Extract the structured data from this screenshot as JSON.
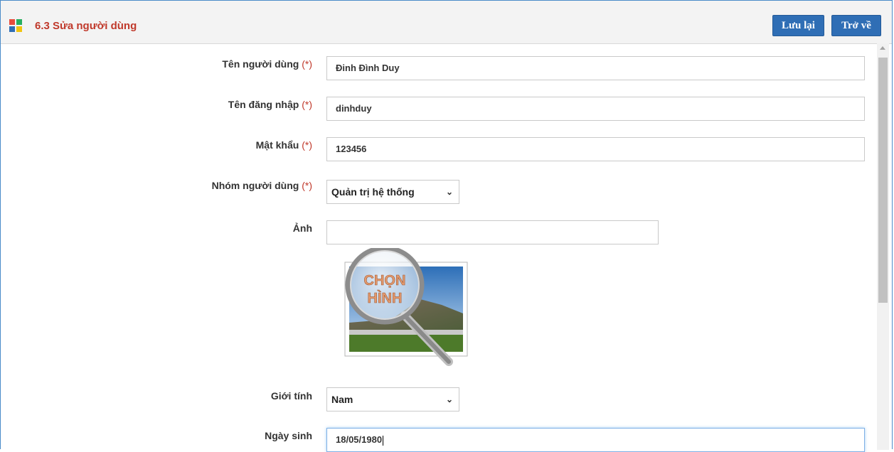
{
  "header": {
    "title": "6.3 Sửa người dùng",
    "save_label": "Lưu lại",
    "back_label": "Trở về"
  },
  "form": {
    "full_name": {
      "label": "Tên người dùng",
      "required": "(*)",
      "value": "Đinh Đình Duy"
    },
    "username": {
      "label": "Tên đăng nhập",
      "required": "(*)",
      "value": "dinhduy"
    },
    "password": {
      "label": "Mật khẩu",
      "required": "(*)",
      "value": "123456"
    },
    "group": {
      "label": "Nhóm người dùng",
      "required": "(*)",
      "selected": "Quản trị hệ thống"
    },
    "photo": {
      "label": "Ảnh",
      "value": "",
      "picker_text_line1": "CHỌN",
      "picker_text_line2": "HÌNH"
    },
    "gender": {
      "label": "Giới tính",
      "selected": "Nam"
    },
    "birthdate": {
      "label": "Ngày sinh",
      "value": "18/05/1980"
    }
  },
  "colors": {
    "accent": "#2f6eb5",
    "title": "#c0392b",
    "required": "#c0392b",
    "frame_border": "#4a8bc9"
  }
}
